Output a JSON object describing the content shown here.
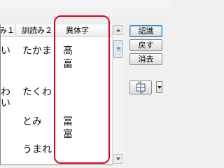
{
  "columns": [
    "み１",
    "訓読み２",
    "異体字"
  ],
  "rows": [
    {
      "col1": "い",
      "col2": "たかま",
      "variants": [
        "髙",
        "畗"
      ]
    },
    {
      "col1": "わ",
      "col1b": "い",
      "col2": "たくわ",
      "variants": []
    },
    {
      "col1": "",
      "col2": "とみ",
      "variants": [
        "冨",
        "富"
      ]
    },
    {
      "col1": "",
      "col2": "うまれ",
      "variants": []
    }
  ],
  "buttons": {
    "recognize": "認識",
    "back": "戻す",
    "delete": "消去"
  },
  "icons": {
    "tool": "grid-swap-icon",
    "dropdown": "chevron-down-icon"
  },
  "colors": {
    "highlight": "#e0001a"
  }
}
